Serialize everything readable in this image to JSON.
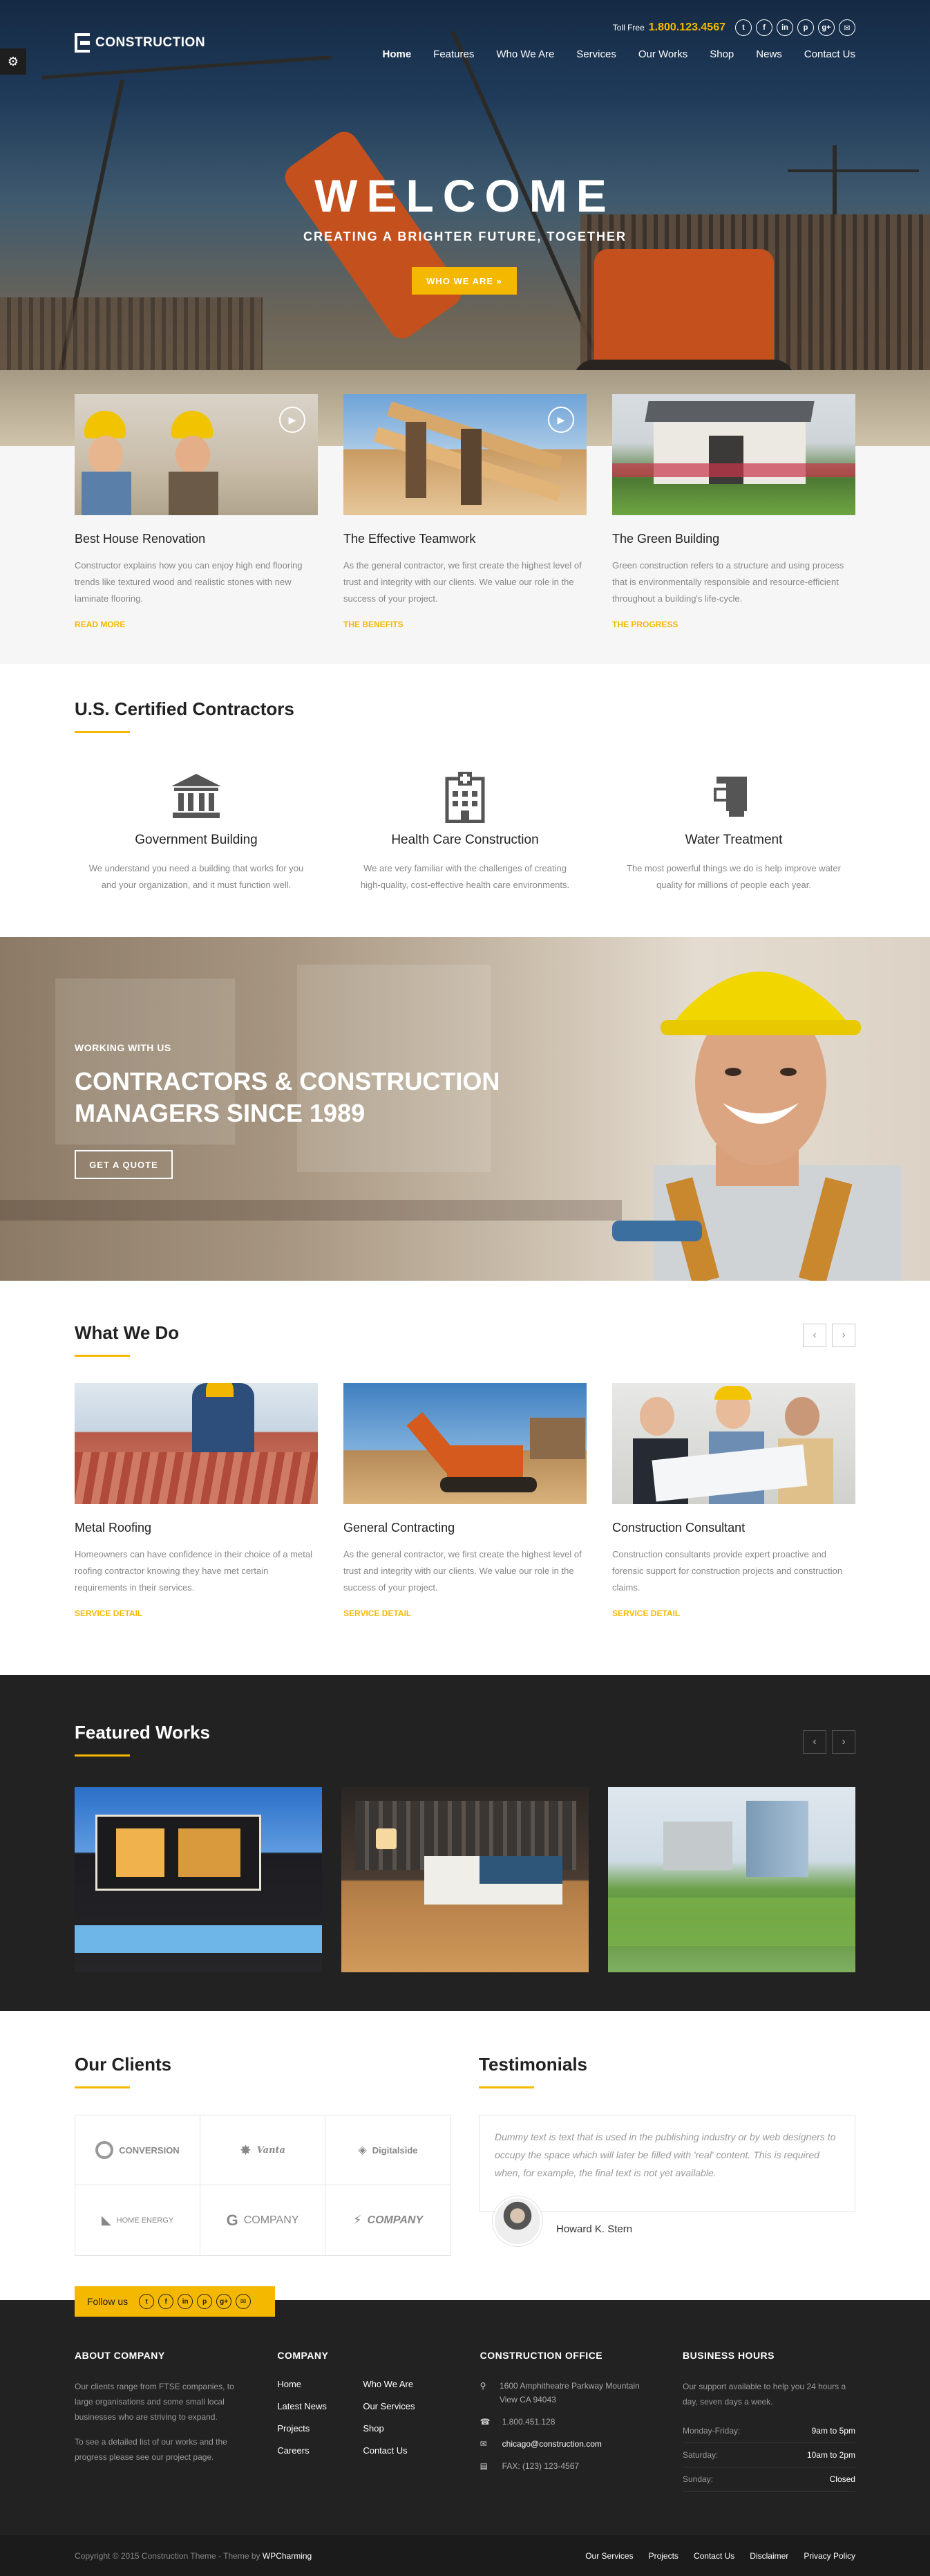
{
  "header": {
    "brand": "CONSTRUCTION",
    "tollfree_label": "Toll Free",
    "tollfree_number": "1.800.123.4567",
    "social": [
      "t",
      "f",
      "in",
      "p",
      "g+",
      "✉"
    ],
    "nav": [
      "Home",
      "Features",
      "Who We Are",
      "Services",
      "Our Works",
      "Shop",
      "News",
      "Contact Us"
    ]
  },
  "hero": {
    "title": "WELCOME",
    "subtitle": "CREATING A BRIGHTER FUTURE, TOGETHER",
    "button": "WHO WE ARE »"
  },
  "features": [
    {
      "title": "Best House Renovation",
      "text": "Constructor explains how you can enjoy high end flooring trends like textured wood and realistic stones with new laminate flooring.",
      "link": "READ MORE"
    },
    {
      "title": "The Effective Teamwork",
      "text": "As the general contractor, we first create the highest level of trust and integrity with our clients. We value our role in the success of your project.",
      "link": "THE BENEFITS"
    },
    {
      "title": "The Green Building",
      "text": "Green construction refers to a structure and using process that is environmentally responsible and resource-efficient throughout a building's life-cycle.",
      "link": "THE PROGRESS"
    }
  ],
  "certified": {
    "title": "U.S. Certified Contractors",
    "items": [
      {
        "icon": "bank-icon",
        "title": "Government Building",
        "text": "We understand you need a building that works for you and your organization, and it must function well."
      },
      {
        "icon": "hospital-icon",
        "title": "Health Care Construction",
        "text": "We are very familiar with the challenges of creating high-quality, cost-effective health care environments."
      },
      {
        "icon": "water-tap-icon",
        "title": "Water Treatment",
        "text": "The most powerful things we do is help improve water quality for millions of people each year."
      }
    ]
  },
  "banner": {
    "small": "WORKING WITH US",
    "title": "CONTRACTORS & CONSTRUCTION MANAGERS SINCE 1989",
    "button": "GET A QUOTE"
  },
  "whatwedo": {
    "title": "What We Do",
    "items": [
      {
        "title": "Metal Roofing",
        "text": "Homeowners can have confidence in their choice of a metal roofing contractor knowing they have met certain requirements in their services.",
        "link": "SERVICE DETAIL"
      },
      {
        "title": "General Contracting",
        "text": "As the general contractor, we first create the highest level of trust and integrity with our clients. We value our role in the success of your project.",
        "link": "SERVICE DETAIL"
      },
      {
        "title": "Construction Consultant",
        "text": "Construction consultants provide expert proactive and forensic support for construction projects and construction claims.",
        "link": "SERVICE DETAIL"
      }
    ]
  },
  "featured": {
    "title": "Featured Works"
  },
  "clients": {
    "title": "Our Clients",
    "logos": [
      "CONVERSION",
      "Vanta",
      "Digitalside",
      "HOME ENERGY",
      "COMPANY",
      "COMPANY"
    ]
  },
  "testimonials": {
    "title": "Testimonials",
    "quote": "Dummy text is text that is used in the publishing industry or by web designers to occupy the space which will later be filled with 'real' content. This is required when, for example, the final text is not yet available.",
    "author": "Howard K. Stern"
  },
  "footer": {
    "follow": "Follow us",
    "about_title": "ABOUT COMPANY",
    "about_p1": "Our clients range from FTSE companies, to large organisations and some small local businesses who are striving to expand.",
    "about_p2": "To see a detailed list of our works and the progress please see our project page.",
    "company_title": "COMPANY",
    "company_links": [
      "Home",
      "Who We Are",
      "Latest News",
      "Our Services",
      "Projects",
      "Shop",
      "Careers",
      "Contact Us"
    ],
    "office_title": "CONSTRUCTION OFFICE",
    "address": "1600 Amphitheatre Parkway Mountain View CA 94043",
    "phone": "1.800.451.128",
    "email": "chicago@construction.com",
    "fax": "FAX: (123) 123-4567",
    "hours_title": "BUSINESS HOURS",
    "hours_text": "Our support available to help you 24 hours a day, seven days a week.",
    "hours": [
      {
        "day": "Monday-Friday:",
        "time": "9am to 5pm"
      },
      {
        "day": "Saturday:",
        "time": "10am to 2pm"
      },
      {
        "day": "Sunday:",
        "time": "Closed"
      }
    ],
    "copyright": "Copyright © 2015 Construction Theme - Theme by",
    "copyright_brand": "WPCharming",
    "bottom_links": [
      "Our Services",
      "Projects",
      "Contact Us",
      "Disclaimer",
      "Privacy Policy"
    ]
  },
  "colors": {
    "accent": "#f5b800",
    "dark": "#222222"
  }
}
